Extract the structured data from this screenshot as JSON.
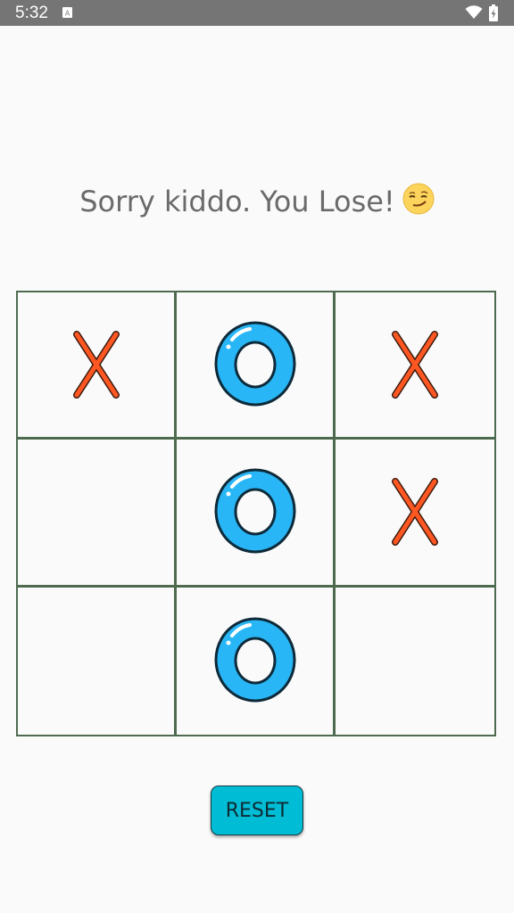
{
  "status_bar": {
    "time": "5:32",
    "notification_icon": "a-box-icon",
    "wifi_icon": "wifi-icon",
    "battery_icon": "battery-charging-icon"
  },
  "game": {
    "message": "Sorry kiddo. You Lose!",
    "message_emoji": "smirking-face-emoji",
    "board": [
      [
        "X",
        "O",
        "X"
      ],
      [
        "",
        "O",
        "X"
      ],
      [
        "",
        "O",
        ""
      ]
    ],
    "reset_label": "RESET"
  },
  "colors": {
    "x_mark": "#ff5722",
    "o_mark": "#29b6f6",
    "grid": "#4e6a4e",
    "reset_button": "#00bcd4",
    "status_bar": "#757575"
  }
}
